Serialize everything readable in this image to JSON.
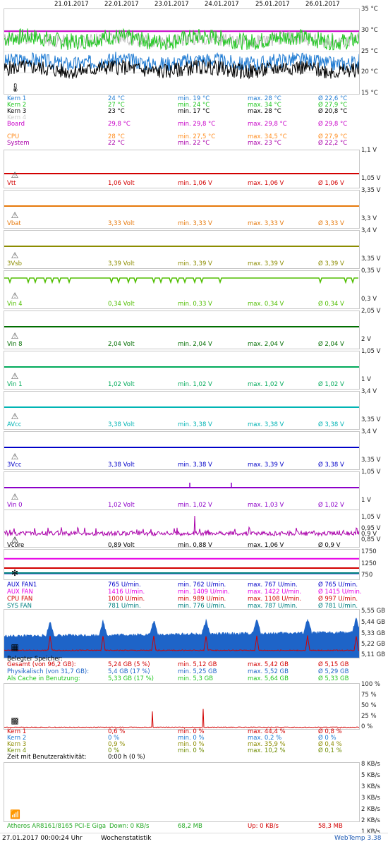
{
  "header": {
    "dates": [
      "21.01.2017",
      "22.01.2017",
      "23.01.2017",
      "24.01.2017",
      "25.01.2017",
      "26.01.2017"
    ]
  },
  "temp": {
    "y_labels": [
      "35 °C",
      "30 °C",
      "25 °C",
      "20 °C",
      "15 °C"
    ],
    "rows": [
      {
        "name": "Kern 1",
        "cur": "24 °C",
        "min": "min. 19 °C",
        "max": "max. 28 °C",
        "avg": "Ø 22,6 °C",
        "color": "#1e7ad2"
      },
      {
        "name": "Kern 2",
        "cur": "27 °C",
        "min": "min. 24 °C",
        "max": "max. 34 °C",
        "avg": "Ø 27,9 °C",
        "color": "#22c822"
      },
      {
        "name": "Kern 3",
        "cur": "23 °C",
        "min": "min. 17 °C",
        "max": "max. 28 °C",
        "avg": "Ø 20,8 °C",
        "color": "#000000"
      },
      {
        "name": "Kern 4",
        "cur": "",
        "min": "",
        "max": "",
        "avg": "",
        "color": "#cccccc"
      },
      {
        "name": "Board",
        "cur": "29,8 °C",
        "min": "min. 29,8 °C",
        "max": "max. 29,8 °C",
        "avg": "Ø 29,8 °C",
        "color": "#c800c8"
      },
      {
        "name": "",
        "cur": "",
        "min": "",
        "max": "",
        "avg": "",
        "color": "#d8d8d8"
      },
      {
        "name": "CPU",
        "cur": "28 °C",
        "min": "min. 27,5 °C",
        "max": "max. 34,5 °C",
        "avg": "Ø 27,9 °C",
        "color": "#ff8c1e"
      },
      {
        "name": "System",
        "cur": "22 °C",
        "min": "min. 22 °C",
        "max": "max. 23 °C",
        "avg": "Ø 22,2 °C",
        "color": "#aa00aa"
      }
    ]
  },
  "volt_panels": [
    {
      "name": "Vtt",
      "cur": "1,06 Volt",
      "min": "min. 1,06 V",
      "max": "max. 1,06 V",
      "avg": "Ø 1,06 V",
      "color": "#d20000",
      "top_label": "1,1 V",
      "bottom_label": "1,05 V"
    },
    {
      "name": "Vbat",
      "cur": "3,33 Volt",
      "min": "min. 3,33 V",
      "max": "max. 3,33 V",
      "avg": "Ø 3,33 V",
      "color": "#e6780a",
      "top_label": "3,35 V",
      "bottom_label": "3,3 V"
    },
    {
      "name": "3Vsb",
      "cur": "3,39 Volt",
      "min": "min. 3,39 V",
      "max": "max. 3,39 V",
      "avg": "Ø 3,39 V",
      "color": "#8c8c00",
      "top_label": "3,4 V",
      "bottom_label": "3,35 V"
    },
    {
      "name": "Vin 4",
      "cur": "0,34 Volt",
      "min": "min. 0,33 V",
      "max": "max. 0,34 V",
      "avg": "Ø 0,34 V",
      "color": "#50be00",
      "top_label": "0,35 V",
      "bottom_label": "0,3 V"
    },
    {
      "name": "Vin 8",
      "cur": "2,04 Volt",
      "min": "min. 2,04 V",
      "max": "max. 2,04 V",
      "avg": "Ø 2,04 V",
      "color": "#006e00",
      "top_label": "2,05 V",
      "bottom_label": "2 V"
    },
    {
      "name": "Vin 1",
      "cur": "1,02 Volt",
      "min": "min. 1,02 V",
      "max": "max. 1,02 V",
      "avg": "Ø 1,02 V",
      "color": "#00aa5a",
      "top_label": "1,05 V",
      "bottom_label": "1 V"
    },
    {
      "name": "AVcc",
      "cur": "3,38 Volt",
      "min": "min. 3,38 V",
      "max": "max. 3,38 V",
      "avg": "Ø 3,38 V",
      "color": "#00b4b4",
      "top_label": "3,4 V",
      "bottom_label": "3,35 V"
    },
    {
      "name": "3Vcc",
      "cur": "3,38 Volt",
      "min": "min. 3,38 V",
      "max": "max. 3,39 V",
      "avg": "Ø 3,38 V",
      "color": "#0000c8",
      "top_label": "3,4 V",
      "bottom_label": "3,35 V"
    },
    {
      "name": "Vin 0",
      "cur": "1,02 Volt",
      "min": "min. 1,02 V",
      "max": "max. 1,03 V",
      "avg": "Ø 1,02 V",
      "color": "#8c00c8",
      "top_label": "1,05 V",
      "bottom_label": "1 V"
    }
  ],
  "vcore": {
    "name": "Vcore",
    "cur": "0,89 Volt",
    "min": "min. 0,88 V",
    "max": "max. 1,06 V",
    "avg": "Ø 0,9 V",
    "color": "#aa00aa",
    "labels": [
      "1,05 V",
      "0,95 V",
      "0,9 V",
      "0,85 V"
    ]
  },
  "fans": {
    "labels": [
      "1750",
      "1250",
      "750"
    ],
    "rows": [
      {
        "name": "AUX FAN1",
        "cur": "765 U/min.",
        "min": "min. 762 U/min.",
        "max": "max. 767 U/min.",
        "avg": "Ø 765 U/min.",
        "color": "#0000c8"
      },
      {
        "name": "AUX FAN",
        "cur": "1416 U/min.",
        "min": "min. 1409 U/min.",
        "max": "max. 1422 U/min.",
        "avg": "Ø 1415 U/min.",
        "color": "#e600e6"
      },
      {
        "name": "CPU FAN",
        "cur": "1000 U/min.",
        "min": "min. 989 U/min.",
        "max": "max. 1108 U/min.",
        "avg": "Ø 997 U/min.",
        "color": "#d20000"
      },
      {
        "name": "SYS FAN",
        "cur": "781 U/min.",
        "min": "min. 776 U/min.",
        "max": "max. 787 U/min.",
        "avg": "Ø 781 U/min.",
        "color": "#008080"
      }
    ]
  },
  "memory": {
    "labels": [
      "5,55 GB",
      "5,44 GB",
      "5,33 GB",
      "5,22 GB",
      "5,11 GB"
    ],
    "title": "Belegter Speicher:",
    "rows": [
      {
        "name": "Gesamt (von 96,2 GB):",
        "cur": "5,24 GB (5 %)",
        "min": "min. 5,12 GB",
        "max": "max. 5,42 GB",
        "avg": "Ø 5,15 GB",
        "color": "#d20000"
      },
      {
        "name": "Physikalisch (von 31,7 GB):",
        "cur": "5,4 GB (17 %)",
        "min": "min. 5,25 GB",
        "max": "max. 5,52 GB",
        "avg": "Ø 5,29 GB",
        "color": "#1e64c8"
      },
      {
        "name": "Als Cache in Benutzung:",
        "cur": "5,33 GB (17 %)",
        "min": "min. 5,3 GB",
        "max": "max. 5,64 GB",
        "avg": "Ø 5,33 GB",
        "color": "#22c822"
      }
    ]
  },
  "cpu_load": {
    "labels": [
      "100 %",
      "75 %",
      "50 %",
      "25 %",
      "0 %"
    ],
    "rows": [
      {
        "name": "Kern 1",
        "cur": "0,6 %",
        "min": "min. 0 %",
        "max": "max. 44,4 %",
        "avg": "Ø 0,8 %",
        "color": "#d20000"
      },
      {
        "name": "Kern 2",
        "cur": "0 %",
        "min": "min. 0 %",
        "max": "max. 0,2 %",
        "avg": "Ø 0 %",
        "color": "#1e7ad2"
      },
      {
        "name": "Kern 3",
        "cur": "0,9 %",
        "min": "min. 0 %",
        "max": "max. 35,9 %",
        "avg": "Ø 0,4 %",
        "color": "#8c8c00"
      },
      {
        "name": "Kern 4",
        "cur": "0 %",
        "min": "min. 0 %",
        "max": "max. 10,2 %",
        "avg": "Ø 0,1 %",
        "color": "#6e8c00"
      }
    ],
    "activity_label": "Zeit mit Benutzeraktivität:",
    "activity_value": "0:00 h (0 %)"
  },
  "network": {
    "labels": [
      "8 KB/s",
      "5 KB/s",
      "3 KB/s",
      "3 KB/s",
      "2 KB/s",
      "2 KB/s",
      "1 KB/s"
    ],
    "adapter": "Atheros AR8161/8165 PCI-E Giga",
    "down": "Down: 0 KB/s",
    "down_total": "68,2 MB",
    "up": "Up: 0 KB/s",
    "up_total": "58,3 MB"
  },
  "footer": {
    "timestamp": "27.01.2017 00:00:24 Uhr",
    "label": "Wochenstatistik",
    "version": "WebTemp 3.38"
  }
}
